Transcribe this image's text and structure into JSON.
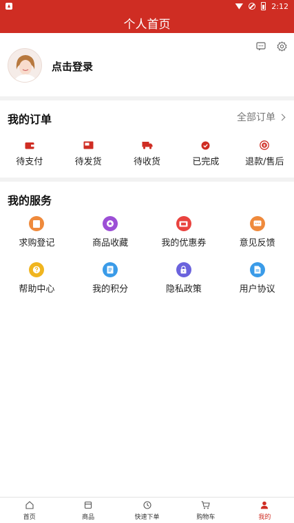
{
  "status": {
    "time": "2:12"
  },
  "header": {
    "title": "个人首页"
  },
  "profile": {
    "login_label": "点击登录",
    "icons": [
      "message-icon",
      "settings-icon"
    ]
  },
  "orders": {
    "title": "我的订单",
    "all_label": "全部订单",
    "items": [
      {
        "label": "待支付",
        "icon": "wallet-icon"
      },
      {
        "label": "待发货",
        "icon": "package-icon"
      },
      {
        "label": "待收货",
        "icon": "truck-icon"
      },
      {
        "label": "已完成",
        "icon": "check-circle-icon"
      },
      {
        "label": "退款/售后",
        "icon": "refund-icon"
      }
    ]
  },
  "services": {
    "title": "我的服务",
    "items": [
      {
        "label": "求购登记",
        "icon": "register-icon",
        "color": "#ef8a3c"
      },
      {
        "label": "商品收藏",
        "icon": "favorite-icon",
        "color": "#9c4fd6"
      },
      {
        "label": "我的优惠券",
        "icon": "coupon-icon",
        "color": "#e9433f"
      },
      {
        "label": "意见反馈",
        "icon": "feedback-icon",
        "color": "#ef8a3c"
      },
      {
        "label": "帮助中心",
        "icon": "help-icon",
        "color": "#f0b51f"
      },
      {
        "label": "我的积分",
        "icon": "points-icon",
        "color": "#3a9be8"
      },
      {
        "label": "隐私政策",
        "icon": "privacy-icon",
        "color": "#6b63dd"
      },
      {
        "label": "用户协议",
        "icon": "agreement-icon",
        "color": "#3a9be8"
      }
    ]
  },
  "tabbar": {
    "items": [
      {
        "label": "首页",
        "icon": "home-icon"
      },
      {
        "label": "商品",
        "icon": "goods-icon"
      },
      {
        "label": "快速下单",
        "icon": "clock-icon"
      },
      {
        "label": "购物车",
        "icon": "cart-icon"
      },
      {
        "label": "我的",
        "icon": "user-icon",
        "active": true
      }
    ]
  },
  "colors": {
    "brand": "#cf2d23"
  }
}
